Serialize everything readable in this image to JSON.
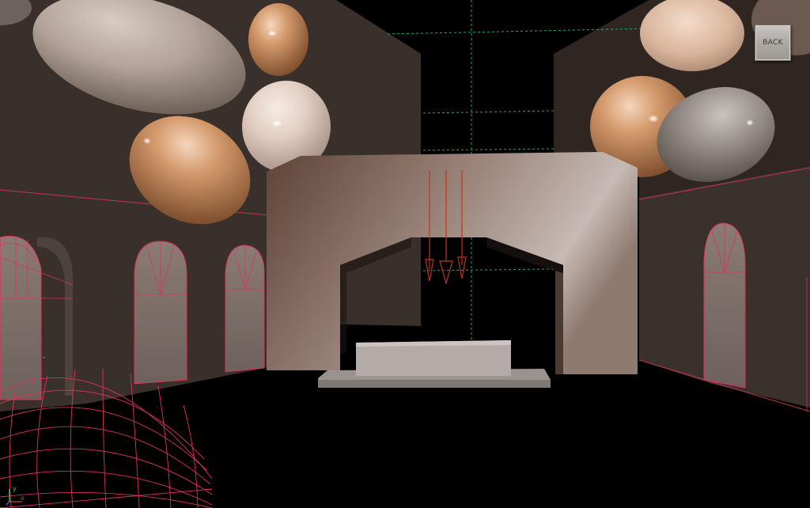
{
  "toolbar": {
    "back_label": "BACK"
  },
  "gizmo": {
    "y_axis_label": "y",
    "x_axis_label": "x"
  },
  "icons": {
    "back": "back-button-icon",
    "axis": "axis-gizmo-icon"
  },
  "colors": {
    "background": "#000000",
    "wall": "#3a302b",
    "wireframe": "#e0305a",
    "grid": "#2fbf8f",
    "button": "#b4b0ac",
    "sphere_warm": "#c68a5e",
    "sphere_cool": "#8f8882"
  }
}
